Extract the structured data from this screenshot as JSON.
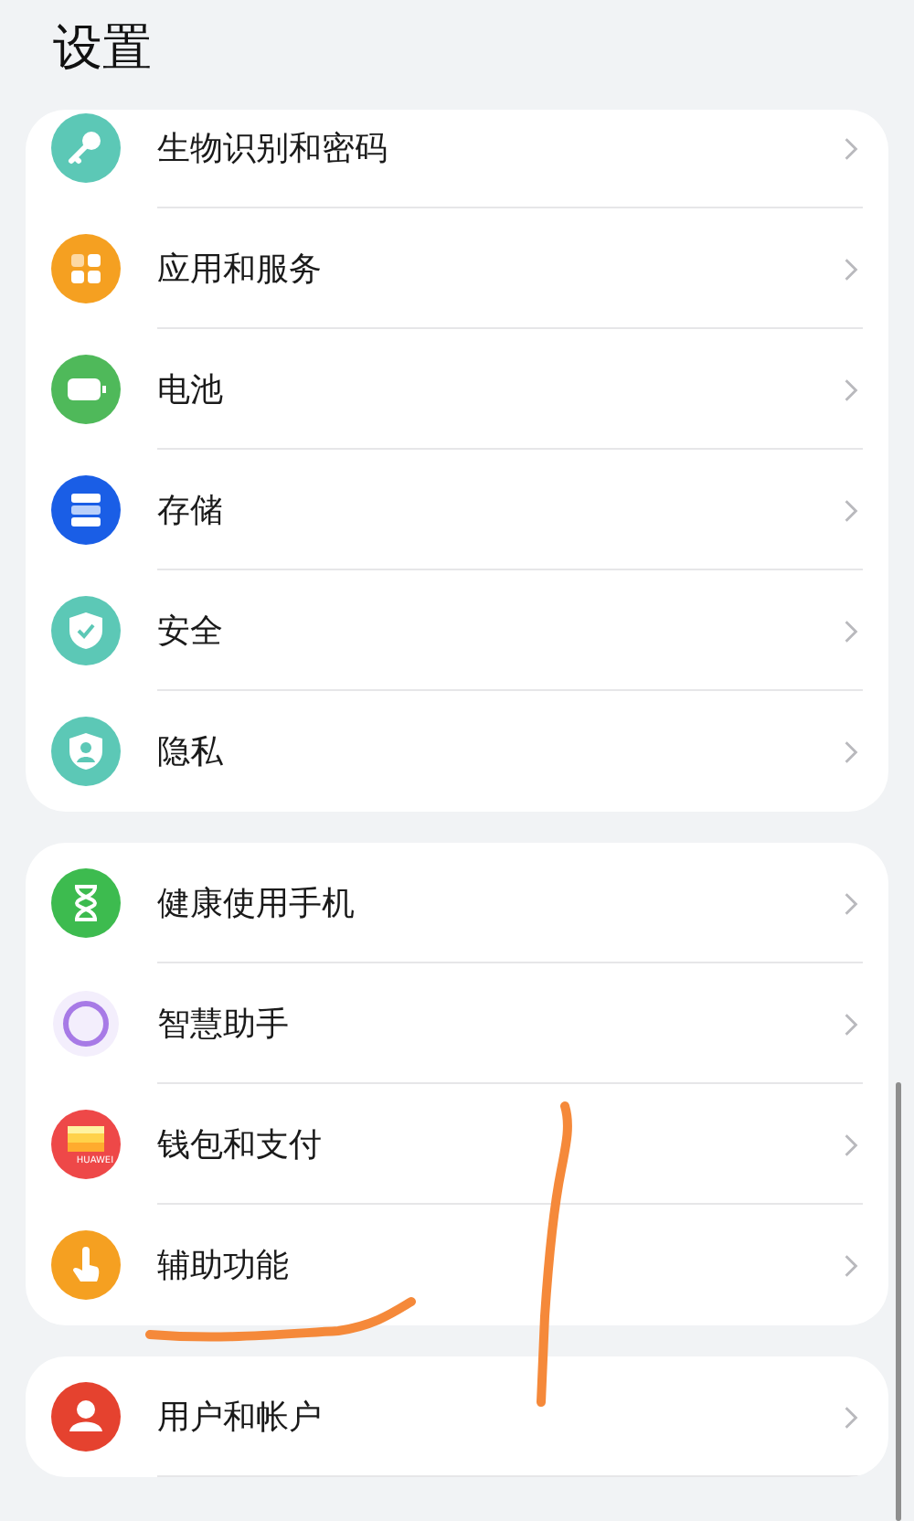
{
  "title": "设置",
  "groups": [
    {
      "items": [
        {
          "label": "生物识别和密码",
          "kind": "key"
        },
        {
          "label": "应用和服务",
          "kind": "apps"
        },
        {
          "label": "电池",
          "kind": "battery"
        },
        {
          "label": "存储",
          "kind": "storage"
        },
        {
          "label": "安全",
          "kind": "security"
        },
        {
          "label": "隐私",
          "kind": "privacy"
        }
      ]
    },
    {
      "items": [
        {
          "label": "健康使用手机",
          "kind": "hourglass"
        },
        {
          "label": "智慧助手",
          "kind": "assistant"
        },
        {
          "label": "钱包和支付",
          "kind": "wallet",
          "icon_text": "HUAWEI"
        },
        {
          "label": "辅助功能",
          "kind": "accessibility"
        }
      ]
    },
    {
      "items": [
        {
          "label": "用户和帐户",
          "kind": "user"
        }
      ]
    }
  ]
}
